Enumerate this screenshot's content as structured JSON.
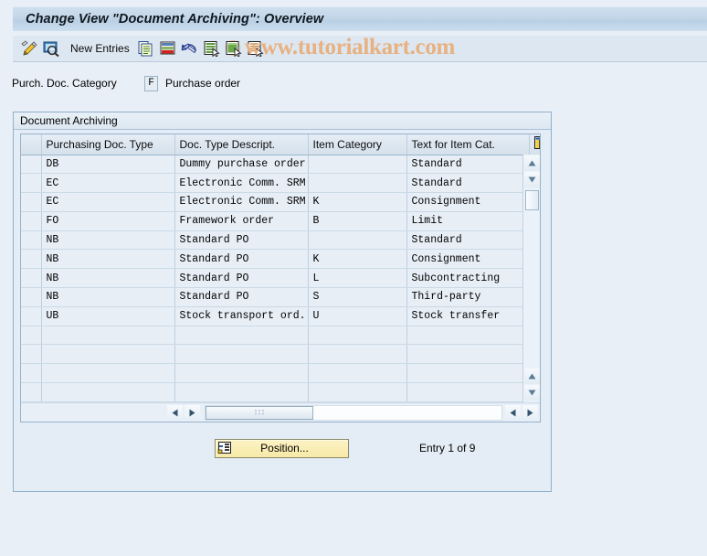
{
  "window": {
    "title": "Change View \"Document Archiving\": Overview"
  },
  "watermark": {
    "text": "www.tutorialkart.com",
    "color": "#e7b182"
  },
  "toolbar": {
    "items": [
      {
        "name": "display-change-icon",
        "label": "",
        "icon": "pencil-toggle-icon"
      },
      {
        "name": "display-detail-icon",
        "label": "",
        "icon": "magnifier-screen-icon"
      },
      {
        "name": "new-entries-button",
        "label": "New Entries",
        "icon": ""
      },
      {
        "name": "copy-as-icon",
        "label": "",
        "icon": "copy-icon"
      },
      {
        "name": "delete-icon",
        "label": "",
        "icon": "delete-row-icon"
      },
      {
        "name": "undo-icon",
        "label": "",
        "icon": "undo-arrow-icon"
      },
      {
        "name": "select-all-icon",
        "label": "",
        "icon": "select-all-icon"
      },
      {
        "name": "deselect-all-icon",
        "label": "",
        "icon": "deselect-all-icon"
      },
      {
        "name": "variable-list-icon",
        "label": "",
        "icon": "list-arrow-icon"
      }
    ],
    "new_entries_label": "New Entries"
  },
  "selection": {
    "label": "Purch. Doc. Category",
    "code": "F",
    "text": "Purchase order"
  },
  "groupbox": {
    "title": "Document Archiving"
  },
  "table": {
    "columns": [
      "Purchasing Doc. Type",
      "Doc. Type Descript.",
      "Item Category",
      "Text for Item Cat."
    ],
    "config_icon": "table-settings-icon",
    "rows": [
      {
        "doc_type": "DB",
        "descript": "Dummy purchase order",
        "item_cat": "",
        "item_cat_text": "Standard"
      },
      {
        "doc_type": "EC",
        "descript": "Electronic Comm. SRM",
        "item_cat": "",
        "item_cat_text": "Standard"
      },
      {
        "doc_type": "EC",
        "descript": "Electronic Comm. SRM",
        "item_cat": "K",
        "item_cat_text": "Consignment"
      },
      {
        "doc_type": "FO",
        "descript": "Framework order",
        "item_cat": "B",
        "item_cat_text": "Limit"
      },
      {
        "doc_type": "NB",
        "descript": "Standard PO",
        "item_cat": "",
        "item_cat_text": "Standard"
      },
      {
        "doc_type": "NB",
        "descript": "Standard PO",
        "item_cat": "K",
        "item_cat_text": "Consignment"
      },
      {
        "doc_type": "NB",
        "descript": "Standard PO",
        "item_cat": "L",
        "item_cat_text": "Subcontracting"
      },
      {
        "doc_type": "NB",
        "descript": "Standard PO",
        "item_cat": "S",
        "item_cat_text": "Third-party"
      },
      {
        "doc_type": "UB",
        "descript": "Stock transport ord.",
        "item_cat": "U",
        "item_cat_text": "Stock transfer"
      },
      {
        "doc_type": "",
        "descript": "",
        "item_cat": "",
        "item_cat_text": ""
      },
      {
        "doc_type": "",
        "descript": "",
        "item_cat": "",
        "item_cat_text": ""
      },
      {
        "doc_type": "",
        "descript": "",
        "item_cat": "",
        "item_cat_text": ""
      },
      {
        "doc_type": "",
        "descript": "",
        "item_cat": "",
        "item_cat_text": ""
      }
    ]
  },
  "footer": {
    "position_label": "Position...",
    "entry_status": "Entry 1 of 9"
  },
  "colors": {
    "page_background": "#e9eff6",
    "titlebar": "#c3d6e8",
    "toolbar": "#dde7f1",
    "grid_cell": "#e7eef6",
    "button_yellow": "#f7e9a8",
    "border": "#8fb0cd"
  }
}
